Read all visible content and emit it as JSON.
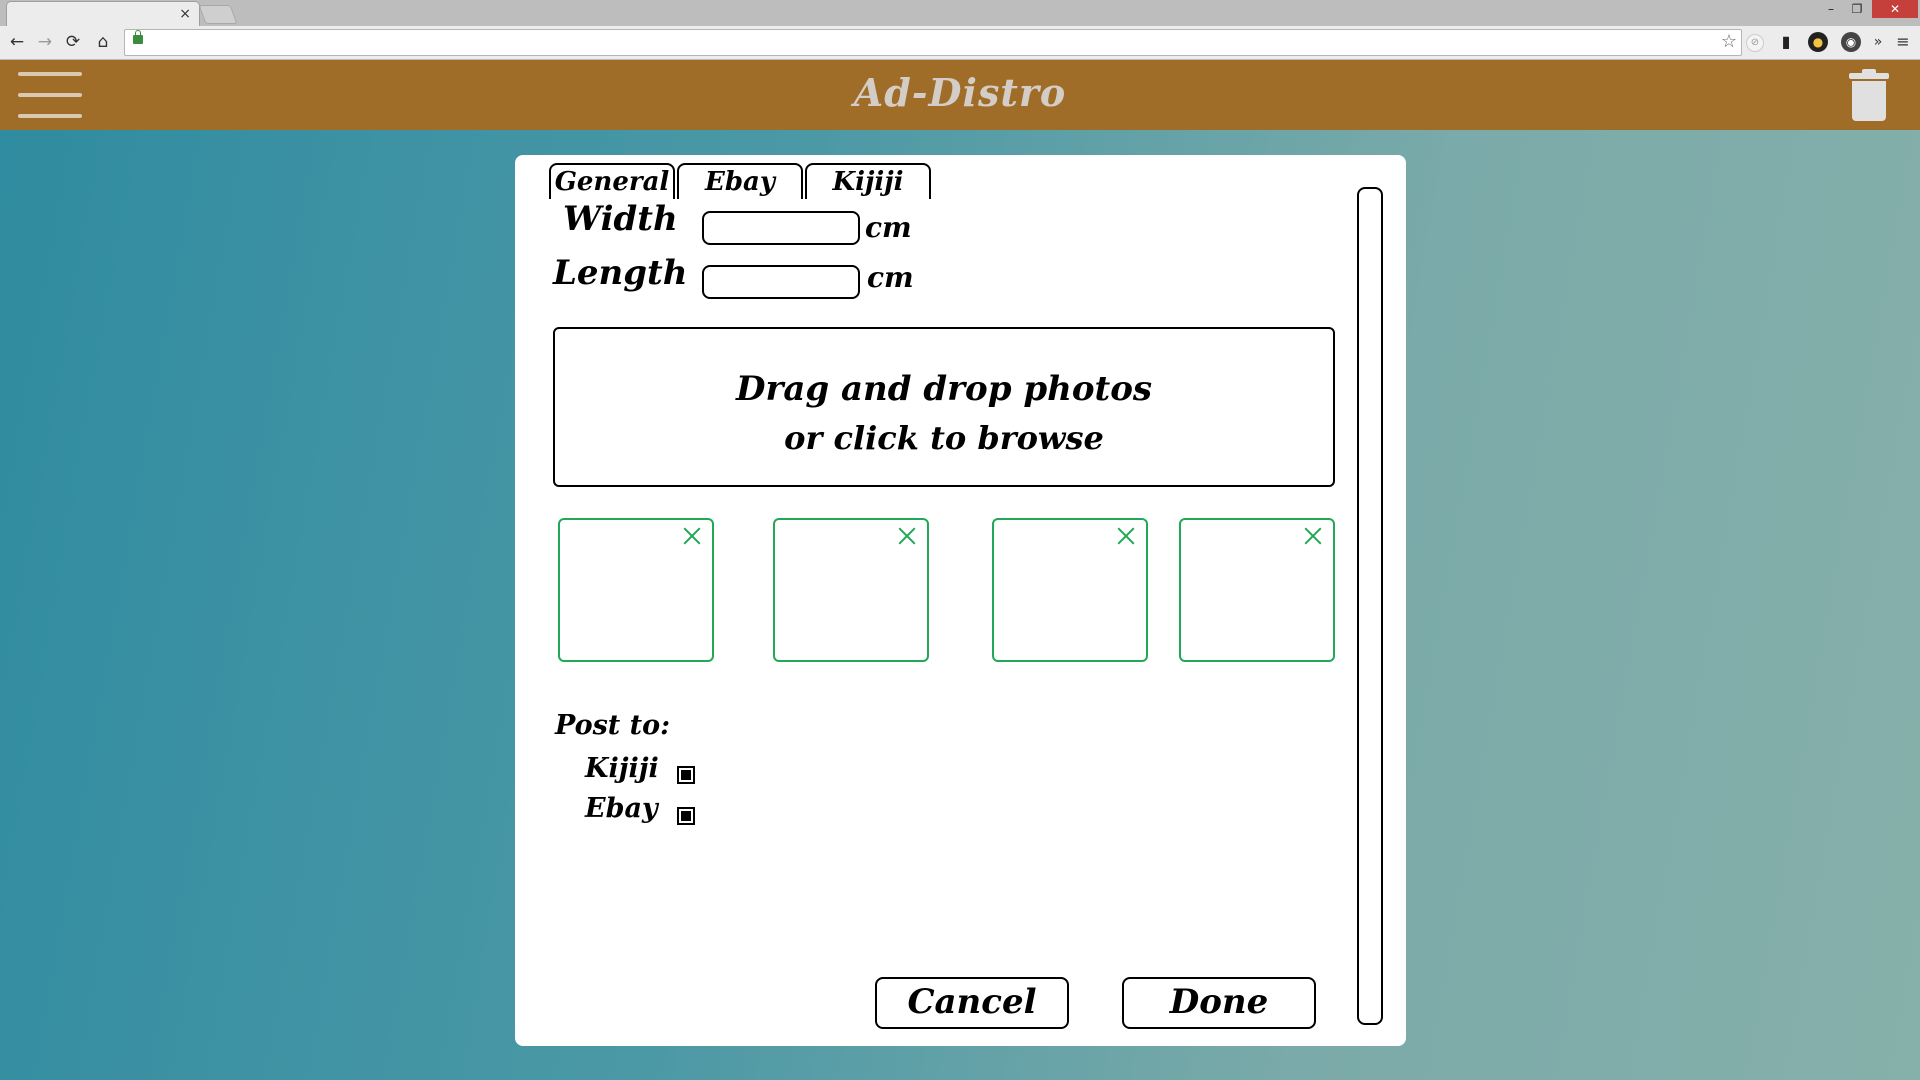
{
  "browser": {
    "tab_close": "×",
    "window_controls": {
      "minimize": "–",
      "maximize": "❐",
      "close": "✕"
    },
    "nav": {
      "back": "←",
      "forward": "→",
      "reload": "⟳",
      "home": "⌂"
    },
    "bookmark_star": "☆",
    "extensions": [
      "⊘",
      "▮",
      "●",
      "◉",
      "»",
      "≡"
    ]
  },
  "app": {
    "title": "Ad-Distro",
    "header_bg": "#a06d28"
  },
  "dialog": {
    "tabs": [
      "General",
      "Ebay",
      "Kijiji"
    ],
    "width_label": "Width",
    "length_label": "Length",
    "width_value": "",
    "length_value": "",
    "width_unit": "cm",
    "length_unit": "cm",
    "dropzone_line1": "Drag and drop photos",
    "dropzone_line2": "or click to browse",
    "thumbnail_accent": "#22a856",
    "post_to_label": "Post to:",
    "post_options": [
      {
        "label": "Kijiji",
        "checked": true
      },
      {
        "label": "Ebay",
        "checked": true
      }
    ],
    "cancel_label": "Cancel",
    "done_label": "Done"
  }
}
